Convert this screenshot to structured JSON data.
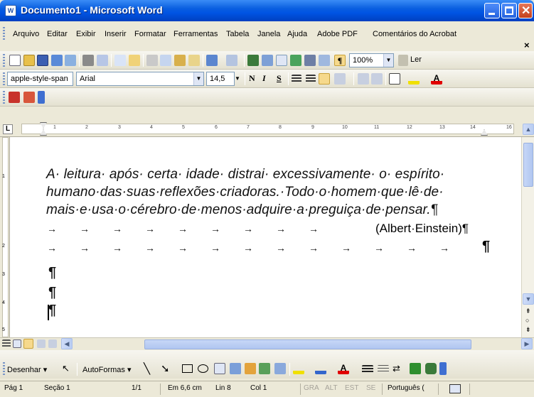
{
  "window": {
    "title": "Documento1 - Microsoft Word",
    "app_icon": "W"
  },
  "menu": {
    "items": [
      "Arquivo",
      "Editar",
      "Exibir",
      "Inserir",
      "Formatar",
      "Ferramentas",
      "Tabela",
      "Janela",
      "Ajuda",
      "Adobe PDF",
      "Comentários do Acrobat"
    ],
    "close_glyph": "×"
  },
  "standard_toolbar": {
    "zoom": "100%",
    "read_label": "Ler"
  },
  "format_toolbar": {
    "style": "apple-style-span",
    "font": "Arial",
    "size": "14,5",
    "bold": "N",
    "italic": "I",
    "underline": "S"
  },
  "ruler": {
    "numbers": [
      "1",
      "2",
      "3",
      "4",
      "5",
      "6",
      "7",
      "8",
      "9",
      "10",
      "11",
      "12",
      "13",
      "14",
      "16"
    ]
  },
  "vruler": {
    "numbers": [
      "1",
      "2",
      "3",
      "4",
      "5"
    ]
  },
  "document": {
    "lines": [
      "A· leitura· após· certa· idade· distrai· excessivamente· o· espírito·",
      "humano·das·suas·reflexões·criadoras.·Todo·o·homem·que·lê·de·",
      "mais·e·usa·o·cérebro·de·menos·adquire·a·preguiça·de·pensar.¶"
    ],
    "attribution": "(Albert·Einstein)¶",
    "pilcrow": "¶"
  },
  "draw_toolbar": {
    "draw_label": "Desenhar",
    "autoshapes_label": "AutoFormas"
  },
  "status": {
    "page": "Pág 1",
    "section": "Seção 1",
    "page_of": "1/1",
    "position": "Em 6,6 cm",
    "line": "Lin 8",
    "col": "Col 1",
    "rec": "GRA",
    "trk": "ALT",
    "ext": "EST",
    "ovr": "SE",
    "language": "Português ("
  }
}
